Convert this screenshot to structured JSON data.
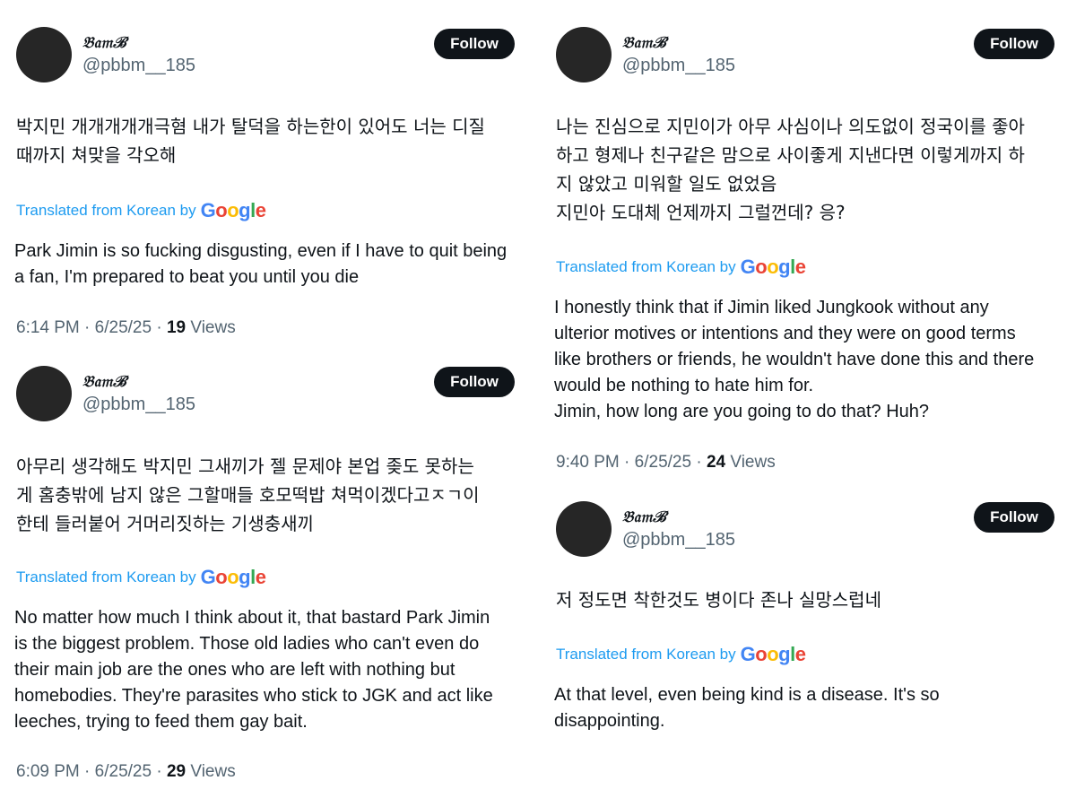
{
  "tweets": [
    {
      "name": "𝔅𝔞𝔪ℬ",
      "handle": "@pbbm__185",
      "follow_label": "Follow",
      "text_ko": "박지민 개개개개개극혐 내가 탈덕을 하는한이 있어도 너는 디질\n때까지  쳐맞을 각오해",
      "translated_label": "Translated from Korean by",
      "text_en": "Park Jimin is so fucking disgusting, even if I have to quit being\na fan, I'm prepared to beat you until you die",
      "time": "6:14 PM",
      "date": "6/25/25",
      "views_count": "19",
      "views_label": "Views"
    },
    {
      "name": "𝔅𝔞𝔪ℬ",
      "handle": "@pbbm__185",
      "follow_label": "Follow",
      "text_ko": "아무리 생각해도 박지민 그새끼가 젤 문제야 본업 좆도 못하는\n게 홈충밖에 남지 않은 그할매들 호모떡밥 쳐먹이겠다고ㅈㄱ이\n한테 들러붙어 거머리짓하는 기생충새끼",
      "translated_label": "Translated from Korean by",
      "text_en": "No matter how much I think about it, that bastard Park Jimin\nis the biggest problem. Those old ladies who can't even do\ntheir main job are the ones who are left with nothing but\nhomebodies. They're parasites who stick to JGK and act like\nleeches, trying to feed them gay bait.",
      "time": "6:09 PM",
      "date": "6/25/25",
      "views_count": "29",
      "views_label": "Views"
    },
    {
      "name": "𝔅𝔞𝔪ℬ",
      "handle": "@pbbm__185",
      "follow_label": "Follow",
      "text_ko": "나는 진심으로 지민이가 아무 사심이나 의도없이 정국이를 좋아\n하고 형제나 친구같은 맘으로 사이좋게 지낸다면 이렇게까지 하\n지 않았고 미워할 일도 없었음\n지민아 도대체 언제까지 그럴껀데? 응?",
      "translated_label": "Translated from Korean by",
      "text_en": "I honestly think that if Jimin liked Jungkook without any\nulterior motives or intentions and they were on good terms\nlike brothers or friends, he wouldn't have done this and there\nwould be nothing to hate him for.\nJimin, how long are you going to do that? Huh?",
      "time": "9:40 PM",
      "date": "6/25/25",
      "views_count": "24",
      "views_label": "Views"
    },
    {
      "name": "𝔅𝔞𝔪ℬ",
      "handle": "@pbbm__185",
      "follow_label": "Follow",
      "text_ko": "저 정도면 착한것도 병이다 존나 실망스럽네",
      "translated_label": "Translated from Korean by",
      "text_en": "At that level, even being kind is a disease. It's so\ndisappointing."
    }
  ],
  "google_logo": {
    "letters": [
      "G",
      "o",
      "o",
      "g",
      "l",
      "e"
    ],
    "colors": [
      "#4285f4",
      "#ea4335",
      "#fbbc05",
      "#4285f4",
      "#34a853",
      "#ea4335"
    ]
  },
  "meta_separator": "·"
}
